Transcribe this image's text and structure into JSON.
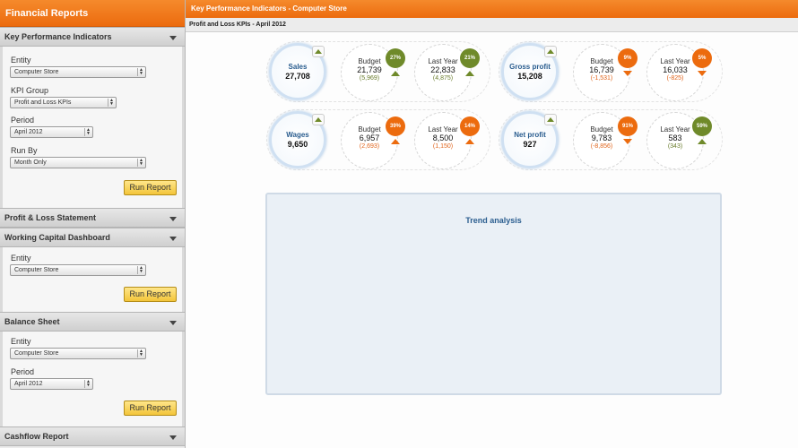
{
  "sidebar": {
    "title": "Financial Reports",
    "kpi_section": {
      "title": "Key Performance Indicators",
      "entity_label": "Entity",
      "entity_value": "Computer Store",
      "kpi_group_label": "KPI Group",
      "kpi_group_value": "Profit and Loss KPIs",
      "period_label": "Period",
      "period_value": "April 2012",
      "runby_label": "Run By",
      "runby_value": "Month Only",
      "run_button": "Run Report"
    },
    "pl_section": {
      "title": "Profit & Loss Statement"
    },
    "wc_section": {
      "title": "Working Capital Dashboard",
      "entity_label": "Entity",
      "entity_value": "Computer Store",
      "run_button": "Run Report"
    },
    "bs_section": {
      "title": "Balance Sheet",
      "entity_label": "Entity",
      "entity_value": "Computer Store",
      "period_label": "Period",
      "period_value": "April 2012",
      "run_button": "Run Report"
    },
    "cf_section": {
      "title": "Cashflow Report"
    }
  },
  "main": {
    "header": "Key Performance Indicators - Computer Store",
    "subheader": "Profit and Loss KPIs - April 2012",
    "budget_label": "Budget",
    "lastyear_label": "Last Year",
    "kpis": {
      "sales": {
        "title": "Sales",
        "value": "27,708",
        "budget": "21,739",
        "budget_diff": "(5,969)",
        "budget_pct": "27%",
        "lastyear": "22,833",
        "lastyear_diff": "(4,875)",
        "lastyear_pct": "21%"
      },
      "gross_profit": {
        "title": "Gross profit",
        "value": "15,208",
        "budget": "16,739",
        "budget_diff": "(-1,531)",
        "budget_pct": "9%",
        "lastyear": "16,033",
        "lastyear_diff": "(-825)",
        "lastyear_pct": "5%"
      },
      "wages": {
        "title": "Wages",
        "value": "9,650",
        "budget": "6,957",
        "budget_diff": "(2,693)",
        "budget_pct": "39%",
        "lastyear": "8,500",
        "lastyear_diff": "(1,150)",
        "lastyear_pct": "14%"
      },
      "net_profit": {
        "title": "Net profit",
        "value": "927",
        "budget": "9,783",
        "budget_diff": "(-8,856)",
        "budget_pct": "91%",
        "lastyear": "583",
        "lastyear_diff": "(343)",
        "lastyear_pct": "59%"
      }
    },
    "trend_title": "Trend analysis"
  },
  "colors": {
    "accent_orange": "#ec6b0e",
    "positive_green": "#6f8a2a",
    "title_blue": "#2a5d8f"
  },
  "icons": {
    "up": "arrow-up-icon",
    "down": "arrow-down-icon",
    "collapse": "chevron-down-icon"
  }
}
